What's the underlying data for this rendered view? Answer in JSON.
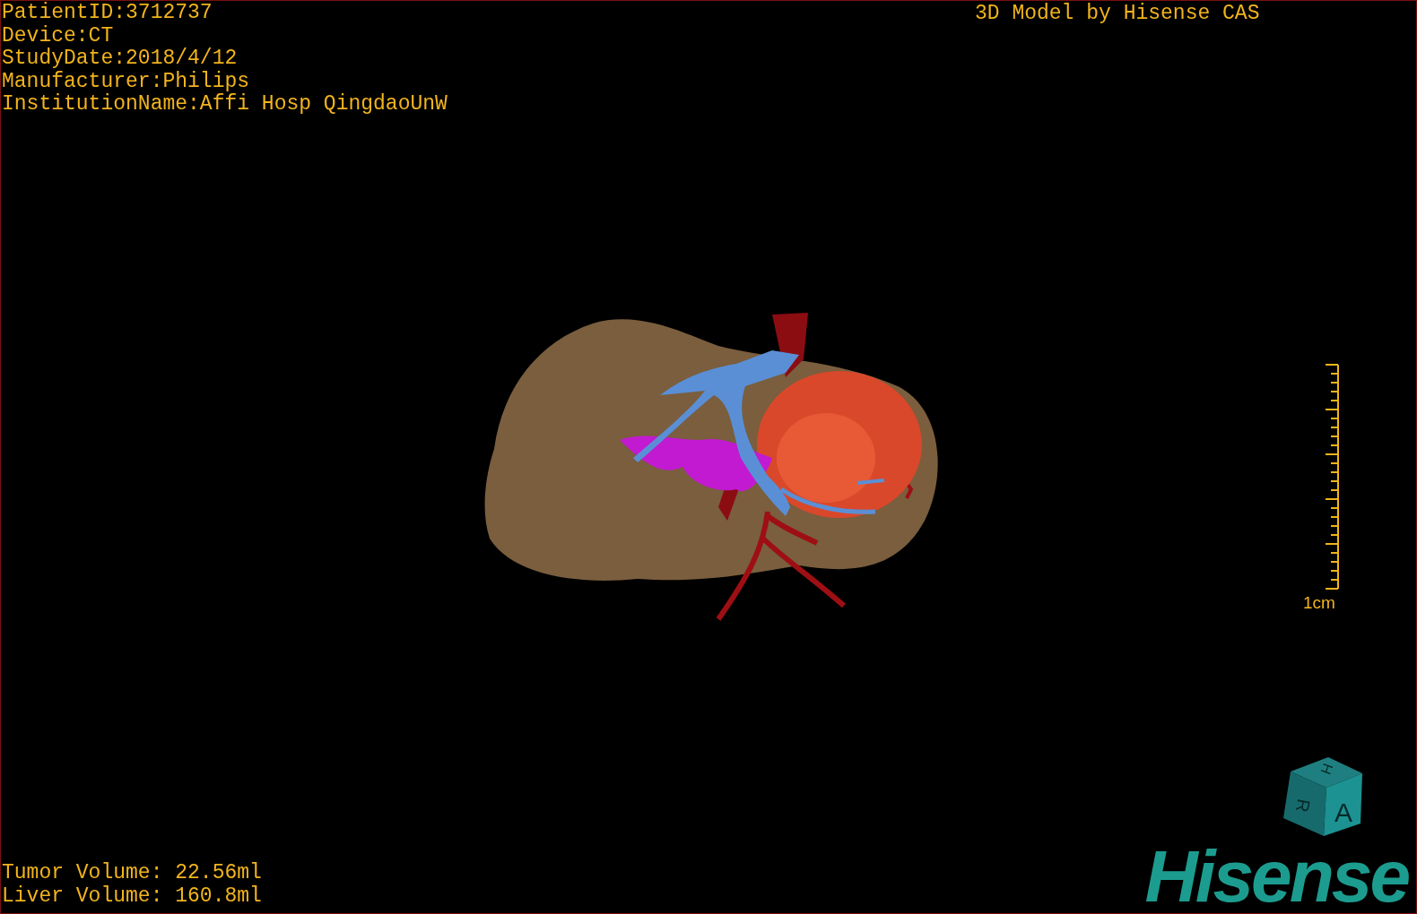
{
  "patient_info": [
    "PatientID:3712737",
    "Device:CT",
    "StudyDate:2018/4/12",
    "Manufacturer:Philips",
    "InstitutionName:Affi Hosp QingdaoUnW"
  ],
  "title": "3D Model by Hisense CAS",
  "scale": {
    "label": "1cm"
  },
  "volumes": [
    "Tumor Volume: 22.56ml",
    "Liver Volume: 160.8ml"
  ],
  "orientation_cube": {
    "top": "H",
    "left": "R",
    "front": "A"
  },
  "logo": "Hisense"
}
